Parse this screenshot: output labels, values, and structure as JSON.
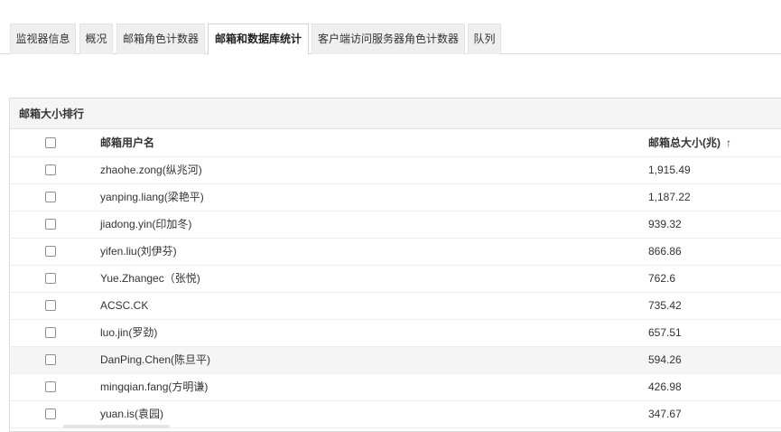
{
  "tabs": [
    {
      "label": "监视器信息",
      "active": false
    },
    {
      "label": "概况",
      "active": false
    },
    {
      "label": "邮箱角色计数器",
      "active": false
    },
    {
      "label": "邮箱和数据库统计",
      "active": true
    },
    {
      "label": "客户端访问服务器角色计数器",
      "active": false
    },
    {
      "label": "队列",
      "active": false
    }
  ],
  "panel": {
    "title": "邮箱大小排行",
    "columns": {
      "name": "邮箱用户名",
      "size": "邮箱总大小(兆)",
      "sort_indicator": "↑"
    },
    "rows": [
      {
        "name": "zhaohe.zong(纵兆河)",
        "size": "1,915.49"
      },
      {
        "name": "yanping.liang(梁艳平)",
        "size": "1,187.22"
      },
      {
        "name": "jiadong.yin(印加冬)",
        "size": "939.32"
      },
      {
        "name": "yifen.liu(刘伊芬)",
        "size": "866.86"
      },
      {
        "name": "Yue.Zhangec（张悦)",
        "size": "762.6"
      },
      {
        "name": "ACSC.CK",
        "size": "735.42"
      },
      {
        "name": "luo.jin(罗劲)",
        "size": "657.51"
      },
      {
        "name": "DanPing.Chen(陈旦平)",
        "size": "594.26"
      },
      {
        "name": "mingqian.fang(方明谦)",
        "size": "426.98"
      },
      {
        "name": "yuan.is(袁园)",
        "size": "347.67"
      }
    ]
  }
}
